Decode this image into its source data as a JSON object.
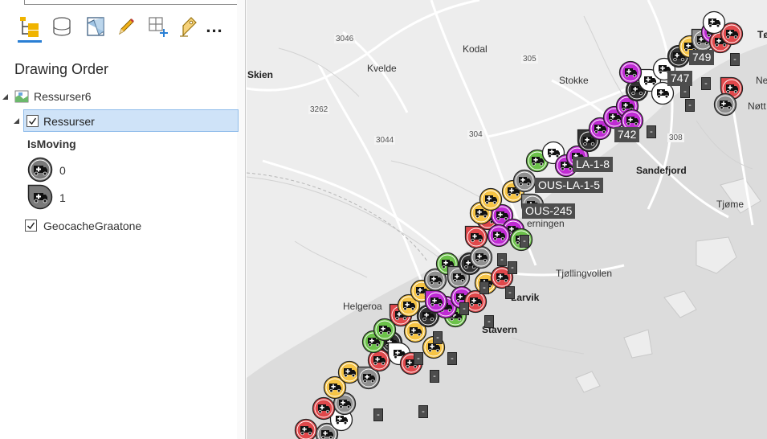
{
  "panel": {
    "title": "Drawing Order",
    "toolbar": [
      {
        "name": "list-by-drawing-order",
        "icon": "drawing-order-icon",
        "active": true
      },
      {
        "name": "list-by-data-source",
        "icon": "database-icon"
      },
      {
        "name": "list-by-selection",
        "icon": "selection-map-icon"
      },
      {
        "name": "list-by-editing",
        "icon": "pencil-icon"
      },
      {
        "name": "list-by-snapping",
        "icon": "snapping-grid-icon"
      },
      {
        "name": "list-by-labeling",
        "icon": "labeling-icon"
      },
      {
        "name": "more",
        "label": "..."
      }
    ],
    "map_name": "Ressurser6",
    "layer": {
      "name": "Ressurser",
      "checked": true,
      "selected": true
    },
    "field": "IsMoving",
    "legend": [
      {
        "value": "0",
        "icon": "ambulance-icon"
      },
      {
        "value": "1",
        "icon": "ambulance-moving-icon"
      }
    ],
    "basemap": {
      "name": "GeocacheGraatone",
      "checked": true
    }
  },
  "map": {
    "places": [
      {
        "id": "skien",
        "label": "Skien",
        "major": true
      },
      {
        "id": "kvelde",
        "label": "Kvelde"
      },
      {
        "id": "kodal",
        "label": "Kodal"
      },
      {
        "id": "stokke",
        "label": "Stokke"
      },
      {
        "id": "sandefjord",
        "label": "Sandefjord",
        "major": true
      },
      {
        "id": "tjome",
        "label": "Tjøme"
      },
      {
        "id": "larvik",
        "label": "Larvik",
        "major": true
      },
      {
        "id": "stavern",
        "label": "Stavern",
        "major": true
      },
      {
        "id": "tjollingvollen",
        "label": "Tjøllingvollen"
      },
      {
        "id": "helgeroa",
        "label": "Helgeroa"
      },
      {
        "id": "kjerningen",
        "label": "erningen"
      },
      {
        "id": "to",
        "label": "Tø",
        "major": true
      },
      {
        "id": "ne",
        "label": "Ne"
      },
      {
        "id": "notte",
        "label": "Nøtt"
      }
    ],
    "roads": [
      "3046",
      "305",
      "3262",
      "3044",
      "304",
      "308"
    ],
    "vehicle_labels": [
      "749",
      "747",
      "742",
      "LA-1-8",
      "OUS-LA-1-5",
      "OUS-245"
    ],
    "marker_colors": {
      "green": "#6cc24a",
      "yellow": "#f6c445",
      "red": "#e0484b",
      "gray": "#8f8f8f",
      "white": "#ffffff",
      "magenta": "#c02bd4",
      "black": "#333333"
    }
  }
}
